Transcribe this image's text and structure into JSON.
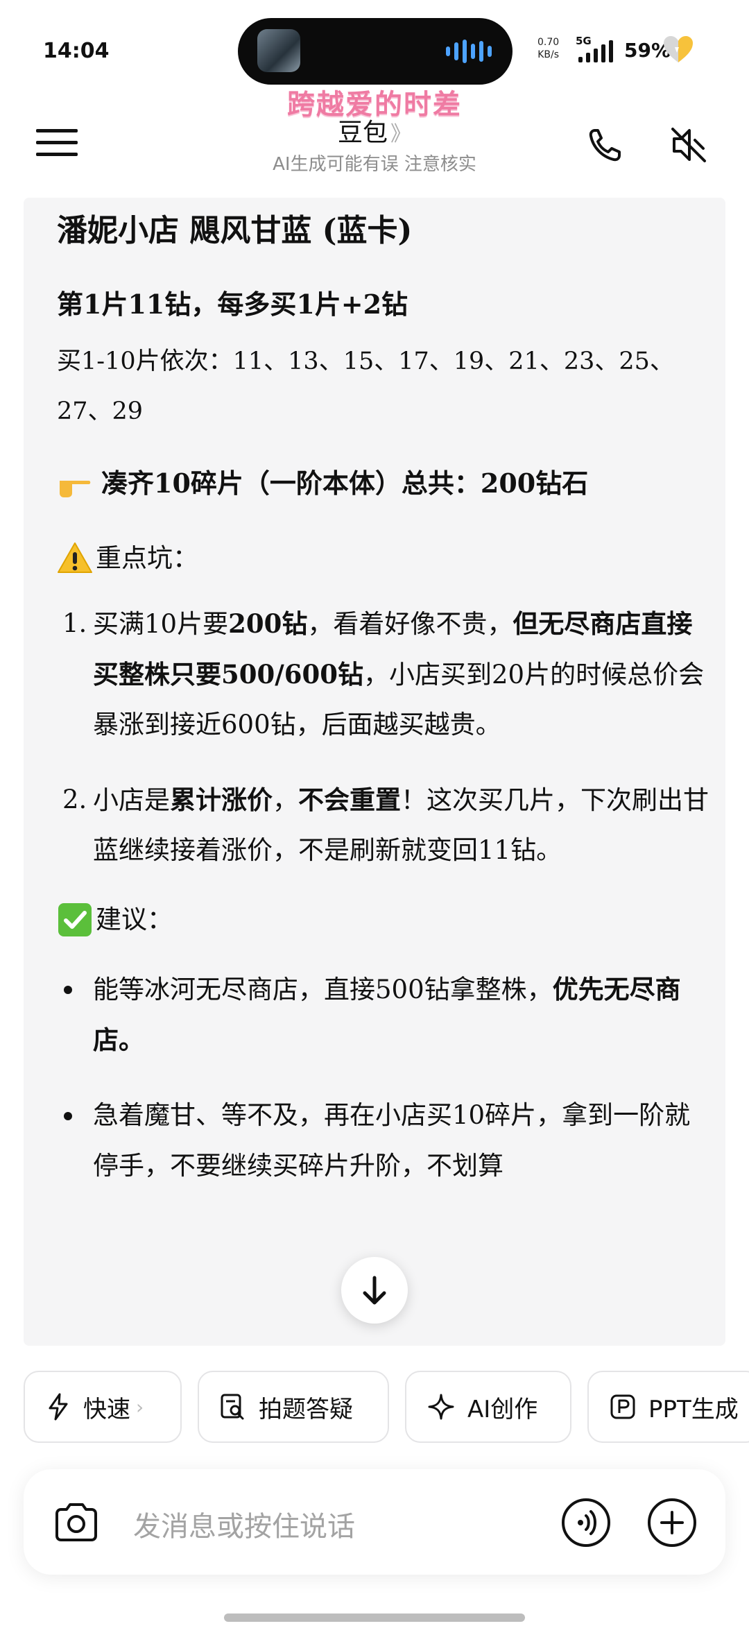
{
  "status": {
    "time": "14:04",
    "net_speed_value": "0.70",
    "net_speed_unit": "KB/s",
    "network": "5G",
    "battery": "59%"
  },
  "header": {
    "banner": "跨越爱的时差",
    "title": "豆包",
    "title_chevron": "》",
    "subtitle": "AI生成可能有误 注意核实"
  },
  "message": {
    "heading": "潘妮小店 飓风甘蓝 (蓝卡)",
    "price_rule": "第1片11钻，每多买1片+2钻",
    "price_list": "买1-10片依次：11、13、15、17、19、21、23、25、27、29",
    "total": "凑齐10碎片（一阶本体）总共：200钻石",
    "pitfalls_title": "重点坑：",
    "pitfalls": [
      {
        "num": "1.",
        "a": "买满10片要",
        "b1": "200钻",
        "c": "，看着好像不贵，",
        "b2": "但无尽商店直接买整株只要500/600钻",
        "d": "，小店买到20片的时候总价会暴涨到接近600钻，后面越买越贵。"
      },
      {
        "num": "2.",
        "a": "小店是",
        "b1": "累计涨价",
        "c": "，",
        "b2": "不会重置",
        "d": "！这次买几片，下次刷出甘蓝继续接着涨价，不是刷新就变回11钻。"
      }
    ],
    "advice_title": "建议：",
    "advice": [
      {
        "text": "能等冰河无尽商店，直接500钻拿整株，",
        "bold": "优先无尽商店。"
      },
      {
        "text": "急着魔甘、等不及，再在小店买10碎片，拿到一阶就停手，不要继续买碎片升阶，不划算",
        "bold": ""
      }
    ]
  },
  "chips": [
    {
      "label": "快速",
      "icon": "lightning-icon",
      "chevron": "›"
    },
    {
      "label": "拍题答疑",
      "icon": "photo-question-icon"
    },
    {
      "label": "AI创作",
      "icon": "sparkle-icon"
    },
    {
      "label": "PPT生成",
      "icon": "ppt-icon"
    }
  ],
  "input": {
    "placeholder": "发消息或按住说话"
  },
  "colors": {
    "banner": "#ef7ba3",
    "card_bg": "#f5f5f6",
    "voice_wave": "#4da3ff",
    "heart_yellow": "#f7c23b"
  }
}
